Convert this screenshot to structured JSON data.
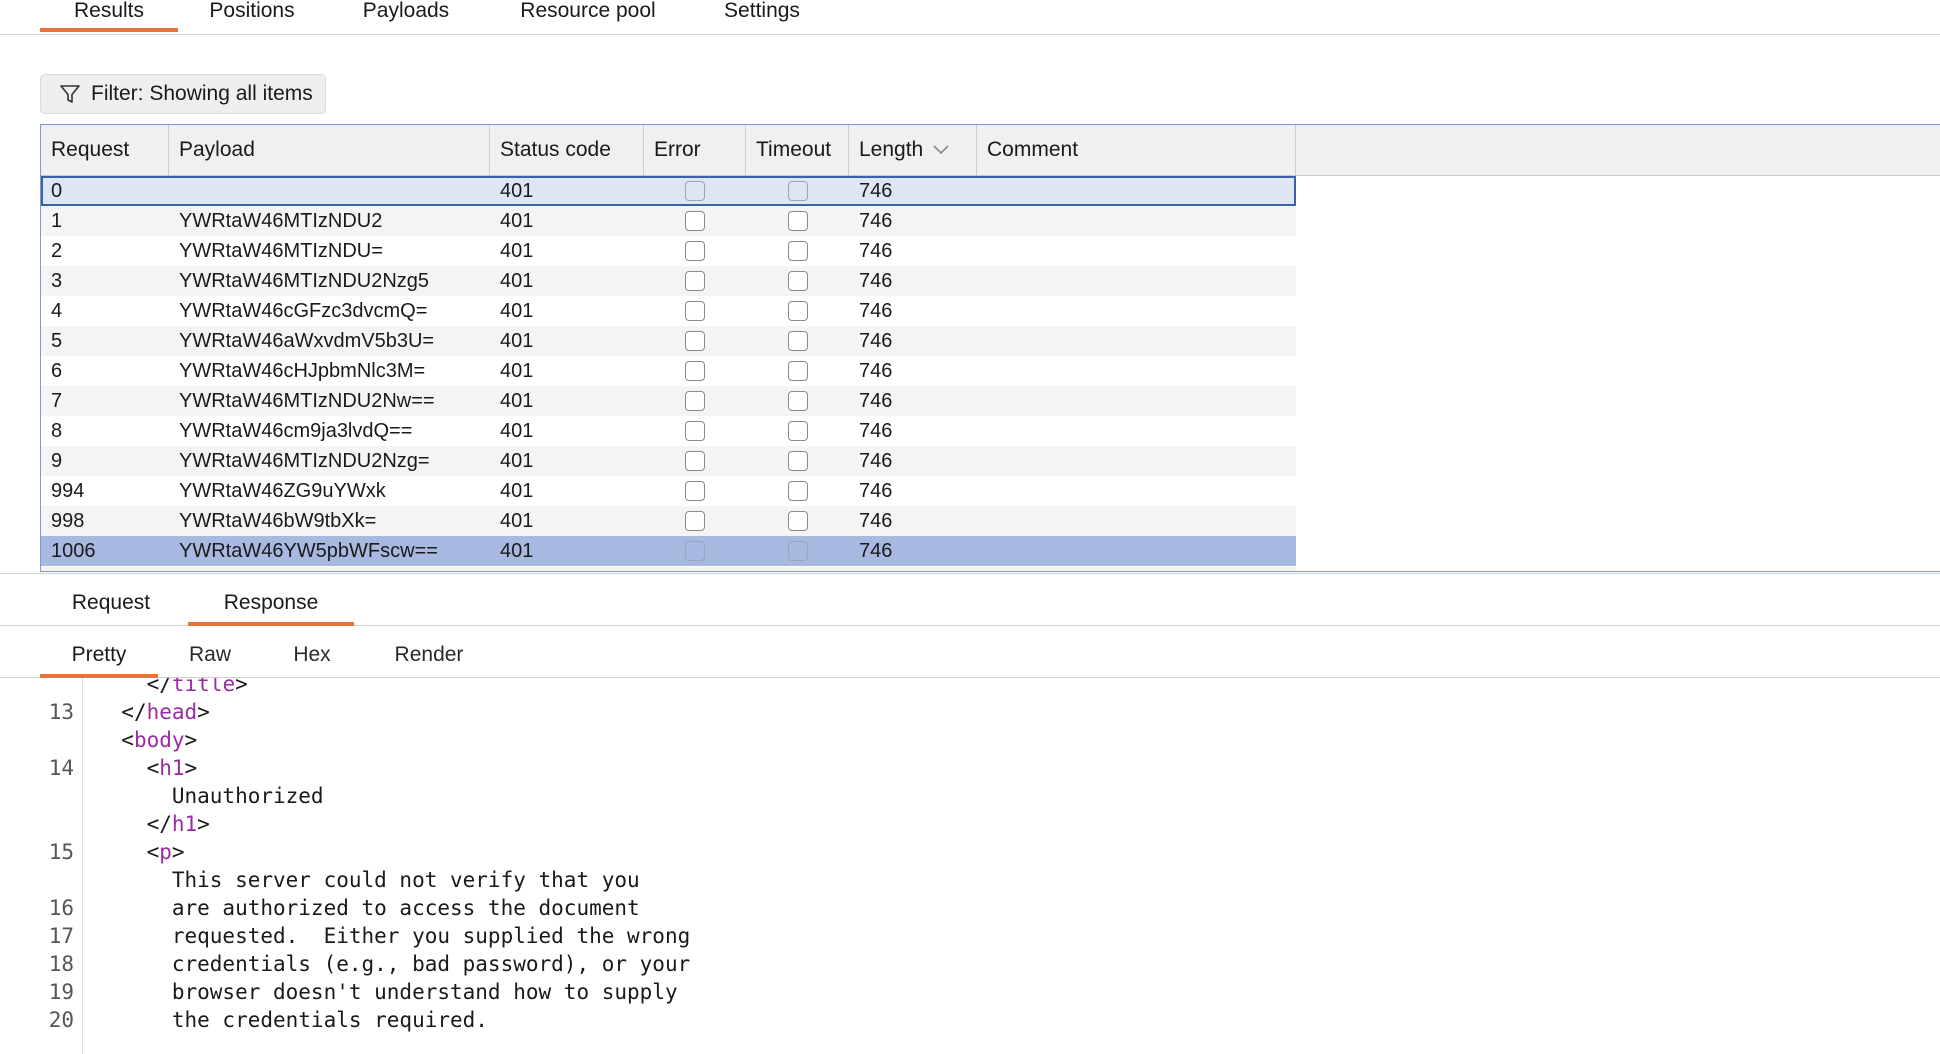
{
  "top_tabs": [
    "Results",
    "Positions",
    "Payloads",
    "Resource pool",
    "Settings"
  ],
  "filter": {
    "label": "Filter: Showing all items",
    "icon": "filter-icon"
  },
  "table": {
    "columns": [
      "Request",
      "Payload",
      "Status code",
      "Error",
      "Timeout",
      "Length",
      "Comment"
    ],
    "sort_icon": "chevron-down-icon",
    "rows": [
      {
        "request": "0",
        "payload": "",
        "status": "401",
        "length": "746"
      },
      {
        "request": "1",
        "payload": "YWRtaW46MTIzNDU2",
        "status": "401",
        "length": "746"
      },
      {
        "request": "2",
        "payload": "YWRtaW46MTIzNDU=",
        "status": "401",
        "length": "746"
      },
      {
        "request": "3",
        "payload": "YWRtaW46MTIzNDU2Nzg5",
        "status": "401",
        "length": "746"
      },
      {
        "request": "4",
        "payload": "YWRtaW46cGFzc3dvcmQ=",
        "status": "401",
        "length": "746"
      },
      {
        "request": "5",
        "payload": "YWRtaW46aWxvdmV5b3U=",
        "status": "401",
        "length": "746"
      },
      {
        "request": "6",
        "payload": "YWRtaW46cHJpbmNlc3M=",
        "status": "401",
        "length": "746"
      },
      {
        "request": "7",
        "payload": "YWRtaW46MTIzNDU2Nw==",
        "status": "401",
        "length": "746"
      },
      {
        "request": "8",
        "payload": "YWRtaW46cm9ja3lvdQ==",
        "status": "401",
        "length": "746"
      },
      {
        "request": "9",
        "payload": "YWRtaW46MTIzNDU2Nzg=",
        "status": "401",
        "length": "746"
      },
      {
        "request": "994",
        "payload": "YWRtaW46ZG9uYWxk",
        "status": "401",
        "length": "746"
      },
      {
        "request": "998",
        "payload": "YWRtaW46bW9tbXk=",
        "status": "401",
        "length": "746"
      },
      {
        "request": "1006",
        "payload": "YWRtaW46YW5pbWFscw==",
        "status": "401",
        "length": "746"
      }
    ]
  },
  "sub_tabs": [
    "Request",
    "Response"
  ],
  "view_tabs": [
    "Pretty",
    "Raw",
    "Hex",
    "Render"
  ],
  "editor": {
    "line_numbers": [
      "13",
      "14",
      "15",
      "16",
      "17",
      "18",
      "19",
      "20"
    ],
    "lines": [
      {
        "indent": "    ",
        "open": "</",
        "tag": "title",
        "close": ">",
        "text": ""
      },
      {
        "indent": "  ",
        "open": "</",
        "tag": "head",
        "close": ">",
        "text": ""
      },
      {
        "indent": "  ",
        "open": "<",
        "tag": "body",
        "close": ">",
        "text": ""
      },
      {
        "indent": "    ",
        "open": "<",
        "tag": "h1",
        "close": ">",
        "text": ""
      },
      {
        "indent": "      ",
        "open": "",
        "tag": "",
        "close": "",
        "text": "Unauthorized"
      },
      {
        "indent": "    ",
        "open": "</",
        "tag": "h1",
        "close": ">",
        "text": ""
      },
      {
        "indent": "    ",
        "open": "<",
        "tag": "p",
        "close": ">",
        "text": ""
      },
      {
        "indent": "      ",
        "open": "",
        "tag": "",
        "close": "",
        "text": "This server could not verify that you"
      },
      {
        "indent": "      ",
        "open": "",
        "tag": "",
        "close": "",
        "text": "are authorized to access the document"
      },
      {
        "indent": "      ",
        "open": "",
        "tag": "",
        "close": "",
        "text": "requested.  Either you supplied the wrong"
      },
      {
        "indent": "      ",
        "open": "",
        "tag": "",
        "close": "",
        "text": "credentials (e.g., bad password), or your"
      },
      {
        "indent": "      ",
        "open": "",
        "tag": "",
        "close": "",
        "text": "browser doesn't understand how to supply"
      },
      {
        "indent": "      ",
        "open": "",
        "tag": "",
        "close": "",
        "text": "the credentials required."
      }
    ]
  },
  "colors": {
    "accent": "#e8743b",
    "selected_row": "#a7b9e0",
    "focus_border": "#3b62a8",
    "tag": "#9b2aa5"
  }
}
